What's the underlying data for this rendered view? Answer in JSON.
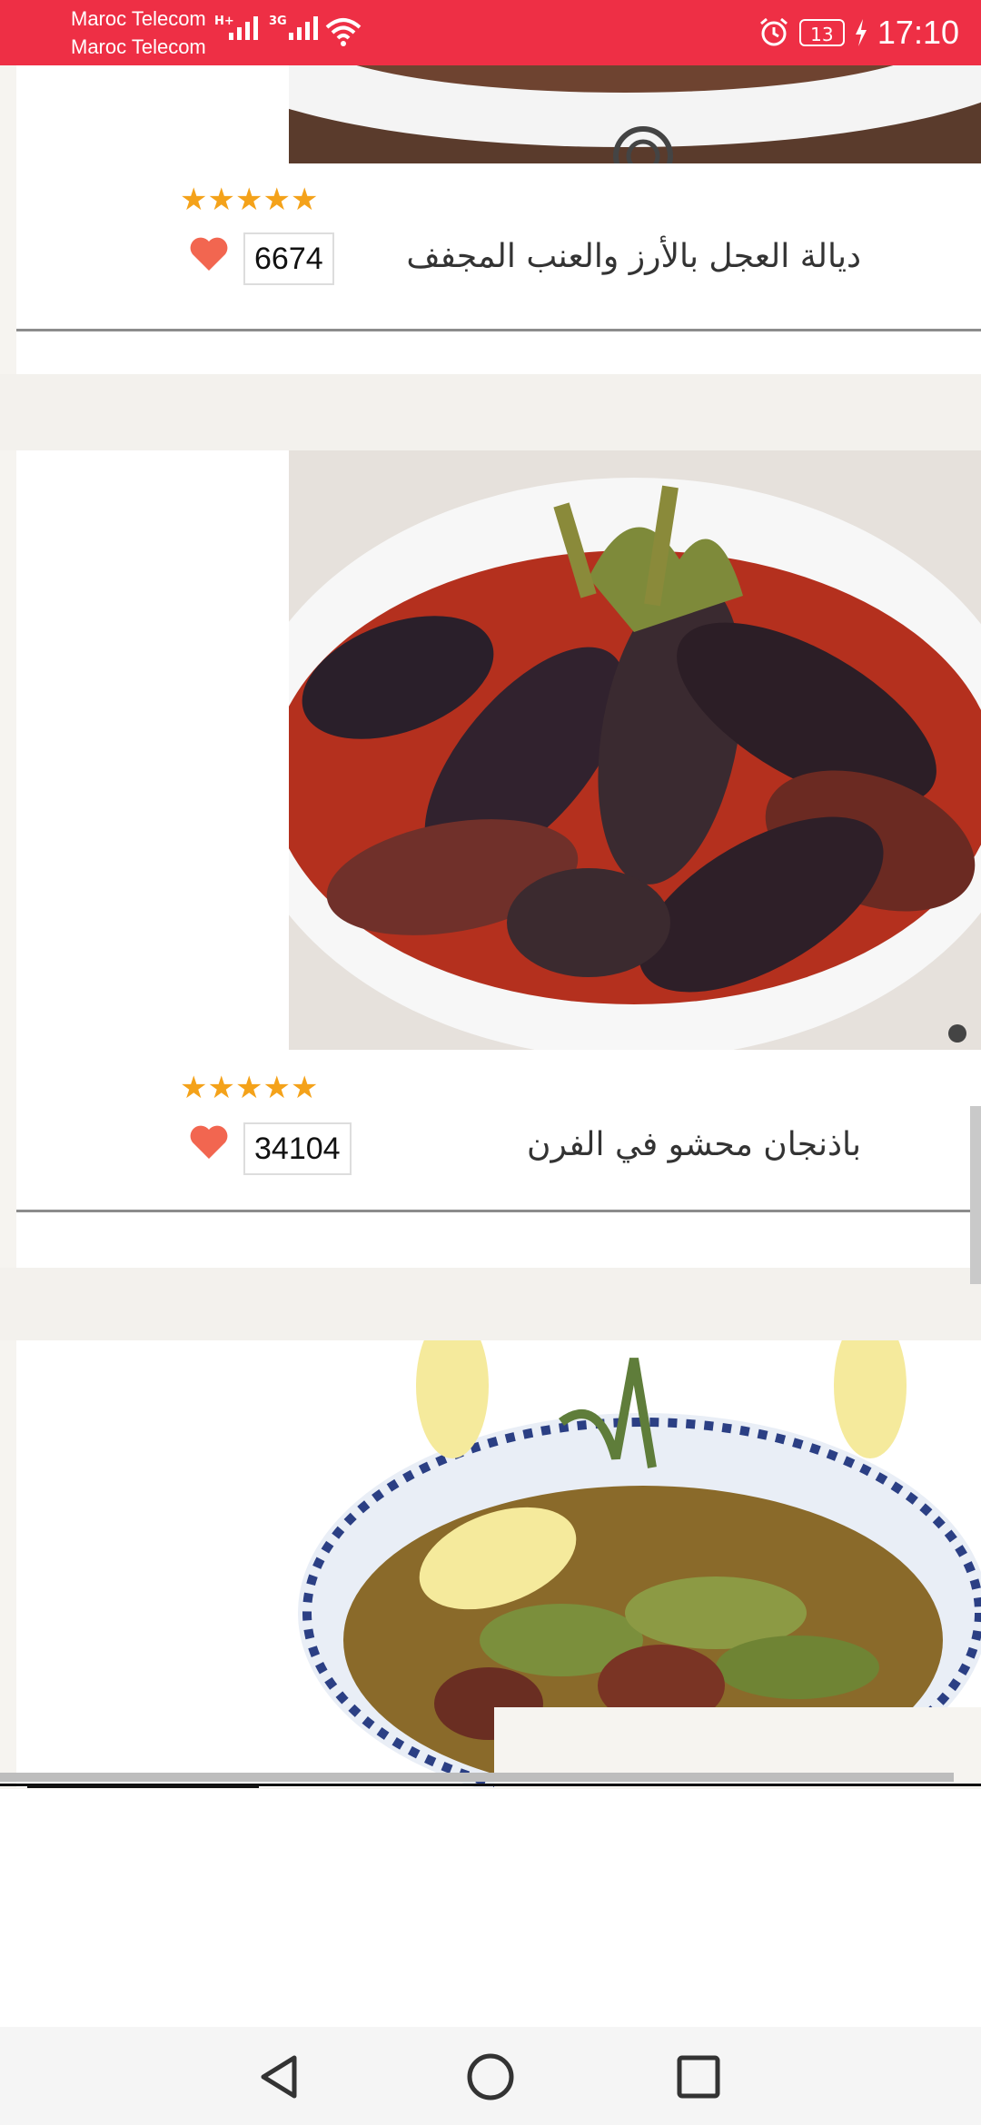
{
  "status_bar": {
    "carrier_1": "Maroc Telecom",
    "carrier_2": "Maroc Telecom",
    "net_1": "H+",
    "net_2": "3G",
    "battery": "13",
    "time": "17:10",
    "accent_color": "#ee2f45"
  },
  "recipes": [
    {
      "title": "ديالة العجل بالأرز والعنب المجفف",
      "count": "6674",
      "rating": 5
    },
    {
      "title": "باذنجان محشو في الفرن",
      "count": "34104",
      "rating": 5
    },
    {
      "title": "",
      "count": "",
      "rating": 0
    }
  ],
  "icons": {
    "star": "star-icon",
    "heart": "heart-icon",
    "back": "back-triangle-icon",
    "home": "home-circle-icon",
    "recents": "recents-square-icon"
  }
}
